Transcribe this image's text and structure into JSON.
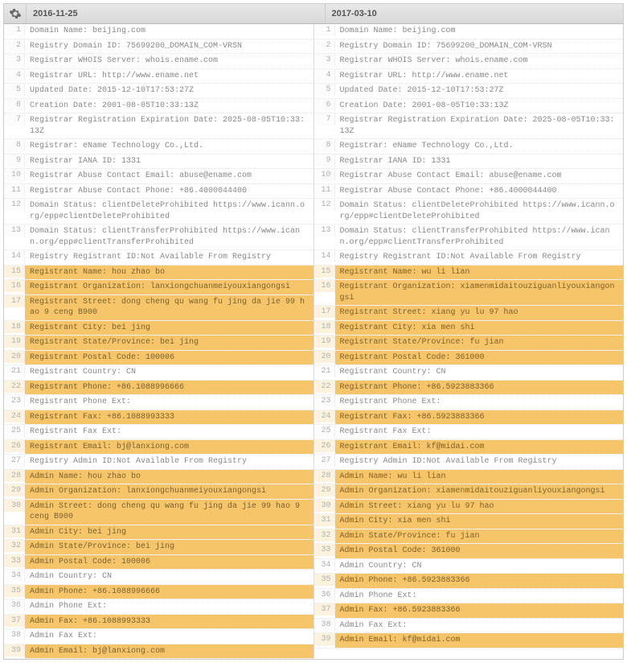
{
  "headers": {
    "left": "2016-11-25",
    "right": "2017-03-10"
  },
  "left_lines": [
    {
      "n": 1,
      "t": "Domain Name: beijing.com",
      "hl": false
    },
    {
      "n": 2,
      "t": "Registry Domain ID: 75699200_DOMAIN_COM-VRSN",
      "hl": false
    },
    {
      "n": 3,
      "t": "Registrar WHOIS Server: whois.ename.com",
      "hl": false
    },
    {
      "n": 4,
      "t": "Registrar URL: http://www.ename.net",
      "hl": false
    },
    {
      "n": 5,
      "t": "Updated Date: 2015-12-10T17:53:27Z",
      "hl": false
    },
    {
      "n": 6,
      "t": "Creation Date: 2001-08-05T10:33:13Z",
      "hl": false
    },
    {
      "n": 7,
      "t": "Registrar Registration Expiration Date: 2025-08-05T10:33:13Z",
      "hl": false
    },
    {
      "n": 8,
      "t": "Registrar: eName Technology Co.,Ltd.",
      "hl": false
    },
    {
      "n": 9,
      "t": "Registrar IANA ID: 1331",
      "hl": false
    },
    {
      "n": 10,
      "t": "Registrar Abuse Contact Email: abuse@ename.com",
      "hl": false
    },
    {
      "n": 11,
      "t": "Registrar Abuse Contact Phone: +86.4000044400",
      "hl": false
    },
    {
      "n": 12,
      "t": "Domain Status: clientDeleteProhibited https://www.icann.org/epp#clientDeleteProhibited",
      "hl": false
    },
    {
      "n": 13,
      "t": "Domain Status: clientTransferProhibited https://www.icann.org/epp#clientTransferProhibited",
      "hl": false
    },
    {
      "n": 14,
      "t": "Registry Registrant ID:Not Available From Registry",
      "hl": false
    },
    {
      "n": 15,
      "t": "Registrant Name: hou zhao bo",
      "hl": true
    },
    {
      "n": 16,
      "t": "Registrant Organization: lanxiongchuanmeiyouxiangongsi",
      "hl": true
    },
    {
      "n": 17,
      "t": "Registrant Street: dong cheng qu wang fu jing da jie 99 hao 9 ceng B900",
      "hl": true
    },
    {
      "n": 18,
      "t": "Registrant City: bei jing",
      "hl": true
    },
    {
      "n": 19,
      "t": "Registrant State/Province: bei jing",
      "hl": true
    },
    {
      "n": 20,
      "t": "Registrant Postal Code: 100006",
      "hl": true
    },
    {
      "n": 21,
      "t": "Registrant Country: CN",
      "hl": false
    },
    {
      "n": 22,
      "t": "Registrant Phone: +86.1088996666",
      "hl": true
    },
    {
      "n": 23,
      "t": "Registrant Phone Ext:",
      "hl": false
    },
    {
      "n": 24,
      "t": "Registrant Fax: +86.1088993333",
      "hl": true
    },
    {
      "n": 25,
      "t": "Registrant Fax Ext:",
      "hl": false
    },
    {
      "n": 26,
      "t": "Registrant Email: bj@lanxiong.com",
      "hl": true
    },
    {
      "n": 27,
      "t": "Registry Admin ID:Not Available From Registry",
      "hl": false
    },
    {
      "n": 28,
      "t": "Admin Name: hou zhao bo",
      "hl": true
    },
    {
      "n": 29,
      "t": "Admin Organization: lanxiongchuanmeiyouxiangongsi",
      "hl": true
    },
    {
      "n": 30,
      "t": "Admin Street: dong cheng qu wang fu jing da jie 99 hao 9 ceng B900",
      "hl": true
    },
    {
      "n": 31,
      "t": "Admin City: bei jing",
      "hl": true
    },
    {
      "n": 32,
      "t": "Admin State/Province: bei jing",
      "hl": true
    },
    {
      "n": 33,
      "t": "Admin Postal Code: 100006",
      "hl": true
    },
    {
      "n": 34,
      "t": "Admin Country: CN",
      "hl": false
    },
    {
      "n": 35,
      "t": "Admin Phone: +86.1088996666",
      "hl": true
    },
    {
      "n": 36,
      "t": "Admin Phone Ext:",
      "hl": false
    },
    {
      "n": 37,
      "t": "Admin Fax: +86.1088993333",
      "hl": true
    },
    {
      "n": 38,
      "t": "Admin Fax Ext:",
      "hl": false
    },
    {
      "n": 39,
      "t": "Admin Email: bj@lanxiong.com",
      "hl": true
    }
  ],
  "right_lines": [
    {
      "n": 1,
      "t": "Domain Name: beijing.com",
      "hl": false
    },
    {
      "n": 2,
      "t": "Registry Domain ID: 75699200_DOMAIN_COM-VRSN",
      "hl": false
    },
    {
      "n": 3,
      "t": "Registrar WHOIS Server: whois.ename.com",
      "hl": false
    },
    {
      "n": 4,
      "t": "Registrar URL: http://www.ename.net",
      "hl": false
    },
    {
      "n": 5,
      "t": "Updated Date: 2015-12-10T17:53:27Z",
      "hl": false
    },
    {
      "n": 6,
      "t": "Creation Date: 2001-08-05T10:33:13Z",
      "hl": false
    },
    {
      "n": 7,
      "t": "Registrar Registration Expiration Date: 2025-08-05T10:33:13Z",
      "hl": false
    },
    {
      "n": 8,
      "t": "Registrar: eName Technology Co.,Ltd.",
      "hl": false
    },
    {
      "n": 9,
      "t": "Registrar IANA ID: 1331",
      "hl": false
    },
    {
      "n": 10,
      "t": "Registrar Abuse Contact Email: abuse@ename.com",
      "hl": false
    },
    {
      "n": 11,
      "t": "Registrar Abuse Contact Phone: +86.4000044400",
      "hl": false
    },
    {
      "n": 12,
      "t": "Domain Status: clientDeleteProhibited https://www.icann.org/epp#clientDeleteProhibited",
      "hl": false
    },
    {
      "n": 13,
      "t": "Domain Status: clientTransferProhibited https://www.icann.org/epp#clientTransferProhibited",
      "hl": false
    },
    {
      "n": 14,
      "t": "Registry Registrant ID:Not Available From Registry",
      "hl": false
    },
    {
      "n": 15,
      "t": "Registrant Name: wu li lian",
      "hl": true
    },
    {
      "n": 16,
      "t": "Registrant Organization: xiamenmidaitouziguanliyouxiangongsi",
      "hl": true
    },
    {
      "n": 17,
      "t": "Registrant Street: xiang yu lu 97 hao",
      "hl": true
    },
    {
      "n": 18,
      "t": "Registrant City: xia men shi",
      "hl": true
    },
    {
      "n": 19,
      "t": "Registrant State/Province: fu jian",
      "hl": true
    },
    {
      "n": 20,
      "t": "Registrant Postal Code: 361000",
      "hl": true
    },
    {
      "n": 21,
      "t": "Registrant Country: CN",
      "hl": false
    },
    {
      "n": 22,
      "t": "Registrant Phone: +86.5923883366",
      "hl": true
    },
    {
      "n": 23,
      "t": "Registrant Phone Ext:",
      "hl": false
    },
    {
      "n": 24,
      "t": "Registrant Fax: +86.5923883366",
      "hl": true
    },
    {
      "n": 25,
      "t": "Registrant Fax Ext:",
      "hl": false
    },
    {
      "n": 26,
      "t": "Registrant Email: kf@midai.com",
      "hl": true
    },
    {
      "n": 27,
      "t": "Registry Admin ID:Not Available From Registry",
      "hl": false
    },
    {
      "n": 28,
      "t": "Admin Name: wu li lian",
      "hl": true
    },
    {
      "n": 29,
      "t": "Admin Organization: xiamenmidaitouziguanliyouxiangongsi",
      "hl": true
    },
    {
      "n": 30,
      "t": "Admin Street: xiang yu lu 97 hao",
      "hl": true
    },
    {
      "n": 31,
      "t": "Admin City: xia men shi",
      "hl": true
    },
    {
      "n": 32,
      "t": "Admin State/Province: fu jian",
      "hl": true
    },
    {
      "n": 33,
      "t": "Admin Postal Code: 361000",
      "hl": true
    },
    {
      "n": 34,
      "t": "Admin Country: CN",
      "hl": false
    },
    {
      "n": 35,
      "t": "Admin Phone: +86.5923883366",
      "hl": true
    },
    {
      "n": 36,
      "t": "Admin Phone Ext:",
      "hl": false
    },
    {
      "n": 37,
      "t": "Admin Fax: +86.5923883366",
      "hl": true
    },
    {
      "n": 38,
      "t": "Admin Fax Ext:",
      "hl": false
    },
    {
      "n": 39,
      "t": "Admin Email: kf@midai.com",
      "hl": true
    }
  ]
}
